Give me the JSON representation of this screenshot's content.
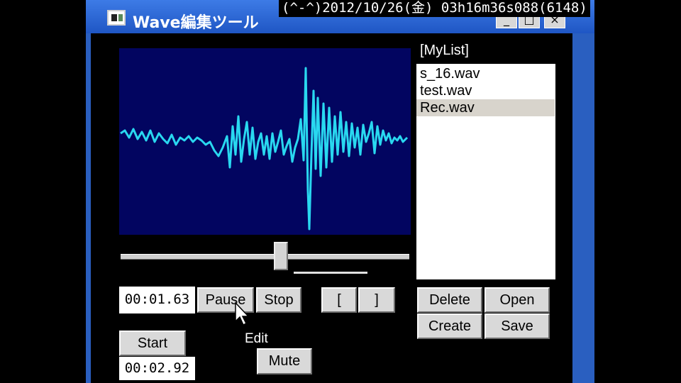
{
  "window": {
    "title": "Wave編集ツール",
    "min_label": "_",
    "max_label": "□",
    "close_label": "×"
  },
  "overlay": {
    "clock": "(^-^)2012/10/26(金) 03h16m36s088(6148)"
  },
  "player": {
    "current_time": "00:01.63",
    "pause_label": "Pause",
    "stop_label": "Stop",
    "mark_in_label": "[",
    "mark_out_label": "]",
    "start_label": "Start",
    "start_time": "00:02.92",
    "edit_label": "Edit",
    "mute_label": "Mute",
    "position_fraction": 0.55
  },
  "list": {
    "label": "[MyList]",
    "items": [
      "s_16.wav",
      "test.wav",
      "Rec.wav"
    ],
    "selected_index": 2,
    "delete_label": "Delete",
    "open_label": "Open",
    "create_label": "Create",
    "save_label": "Save"
  },
  "colors": {
    "window_blue": "#2a5fc0",
    "wave_bg": "#020560",
    "wave_line": "#29d8f0"
  }
}
